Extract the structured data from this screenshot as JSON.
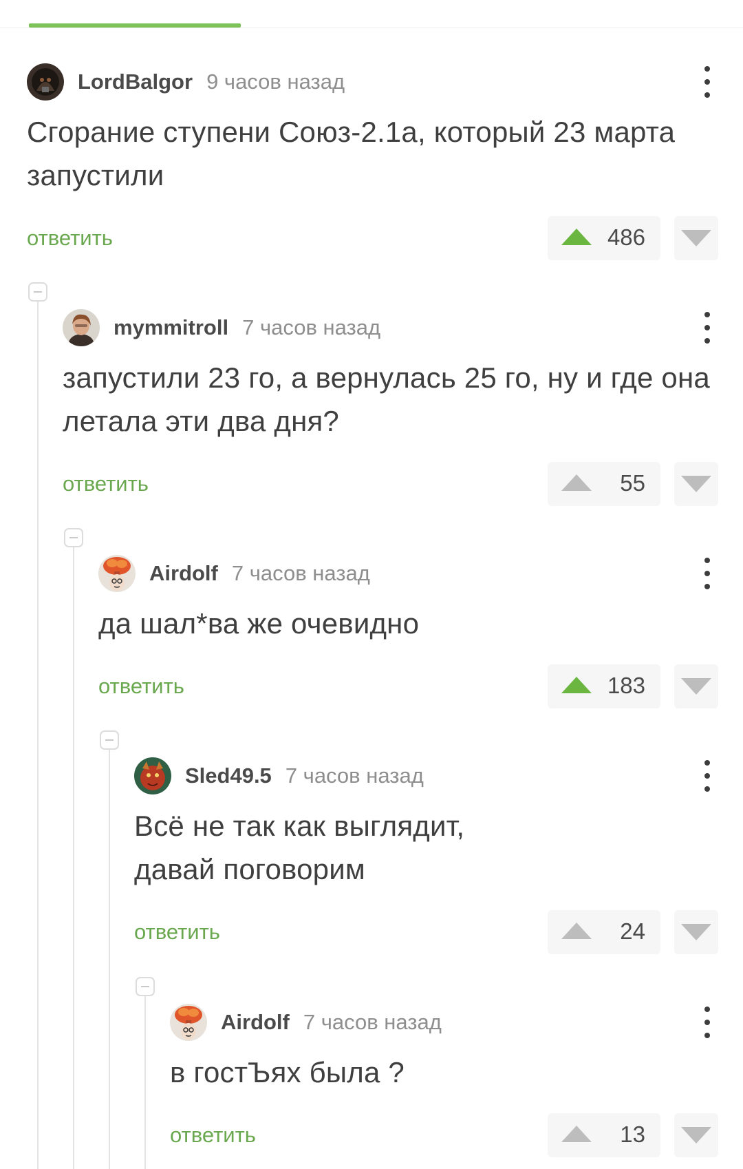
{
  "colors": {
    "accent": "#6aa84f",
    "upvote_active": "#6ab640",
    "upvote_inactive": "#bdbdbd",
    "text": "#3f3f3f",
    "muted": "#8e8e8e",
    "progress": "#7cc35a"
  },
  "comments": [
    {
      "author": "LordBalgor",
      "time": "9 часов назад",
      "text": "Сгорание ступени Союз-2.1а, который 23 марта запустили",
      "reply_label": "ответить",
      "rating": "486",
      "upvoted": true,
      "avatar": "dark-figure-avatar",
      "more_icon": "more-vertical-icon"
    },
    {
      "author": "mymmitroll",
      "time": "7 часов назад",
      "text": "запустили 23 го, а вернулась 25 го, ну и где она летала эти два дня?",
      "reply_label": "ответить",
      "rating": "55",
      "upvoted": false,
      "avatar": "portrait-avatar",
      "more_icon": "more-vertical-icon"
    },
    {
      "author": "Airdolf",
      "time": "7 часов назад",
      "text": "да шал*ва же очевидно",
      "reply_label": "ответить",
      "rating": "183",
      "upvoted": true,
      "avatar": "mushroom-cloud-avatar",
      "more_icon": "more-vertical-icon"
    },
    {
      "author": "Sled49.5",
      "time": "7 часов назад",
      "text": "Всё не так как выглядит, давай поговорим",
      "reply_label": "ответить",
      "rating": "24",
      "upvoted": false,
      "avatar": "red-creature-avatar",
      "more_icon": "more-vertical-icon"
    },
    {
      "author": "Airdolf",
      "time": "7 часов назад",
      "text": "в гостЪях была ?",
      "reply_label": "ответить",
      "rating": "13",
      "upvoted": false,
      "avatar": "mushroom-cloud-avatar",
      "more_icon": "more-vertical-icon"
    }
  ]
}
